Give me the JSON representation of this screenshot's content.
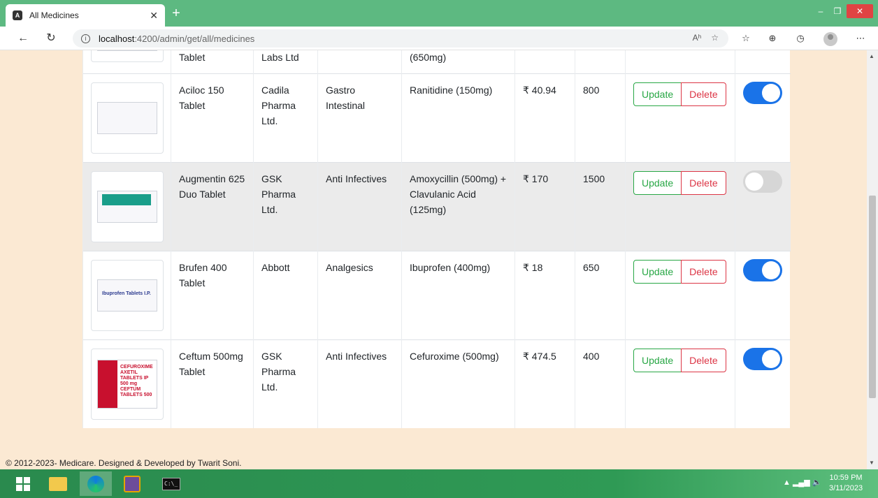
{
  "browser": {
    "tab_title": "All Medicines",
    "tab_favicon": "A",
    "url_host": "localhost",
    "url_path": ":4200/admin/get/all/medicines",
    "new_tab": "+",
    "read_aloud": "Aʰ"
  },
  "partial_row": {
    "name": "Tablet",
    "company": "Labs Ltd",
    "ingredients": "(650mg)"
  },
  "medicines": [
    {
      "name": "Aciloc 150 Tablet",
      "company": "Cadila Pharma Ltd.",
      "category": "Gastro Intestinal",
      "ingredients": "Ranitidine (150mg)",
      "price": "₹ 40.94",
      "stock": "800",
      "enabled": true
    },
    {
      "name": "Augmentin 625 Duo Tablet",
      "company": "GSK Pharma Ltd.",
      "category": "Anti Infectives",
      "ingredients": "Amoxycillin (500mg) + Clavulanic Acid (125mg)",
      "price": "₹ 170",
      "stock": "1500",
      "enabled": false
    },
    {
      "name": "Brufen 400 Tablet",
      "company": "Abbott",
      "category": "Analgesics",
      "ingredients": "Ibuprofen (400mg)",
      "price": "₹ 18",
      "stock": "650",
      "enabled": true
    },
    {
      "name": "Ceftum 500mg Tablet",
      "company": "GSK Pharma Ltd.",
      "category": "Anti Infectives",
      "ingredients": "Cefuroxime (500mg)",
      "price": "₹ 474.5",
      "stock": "400",
      "enabled": true
    }
  ],
  "pack_labels": {
    "brufen": "Ibuprofen Tablets I.P.",
    "ceftum": "CEFUROXIME AXETIL TABLETS IP 500 mg CEFTUM TABLETS 500"
  },
  "buttons": {
    "update": "Update",
    "delete": "Delete"
  },
  "footer": "© 2012-2023- Medicare. Designed & Developed by Twarit Soni.",
  "taskbar": {
    "time": "10:59 PM",
    "date": "3/11/2023",
    "cmd_text": "C:\\_"
  },
  "colors": {
    "tab_bar": "#5db981",
    "page_bg": "#fbe9d3",
    "update_green": "#28a745",
    "delete_red": "#dc3545",
    "toggle_on": "#1a73e8",
    "toggle_off": "#d6d6d6",
    "highlight_row": "#ebebeb"
  }
}
